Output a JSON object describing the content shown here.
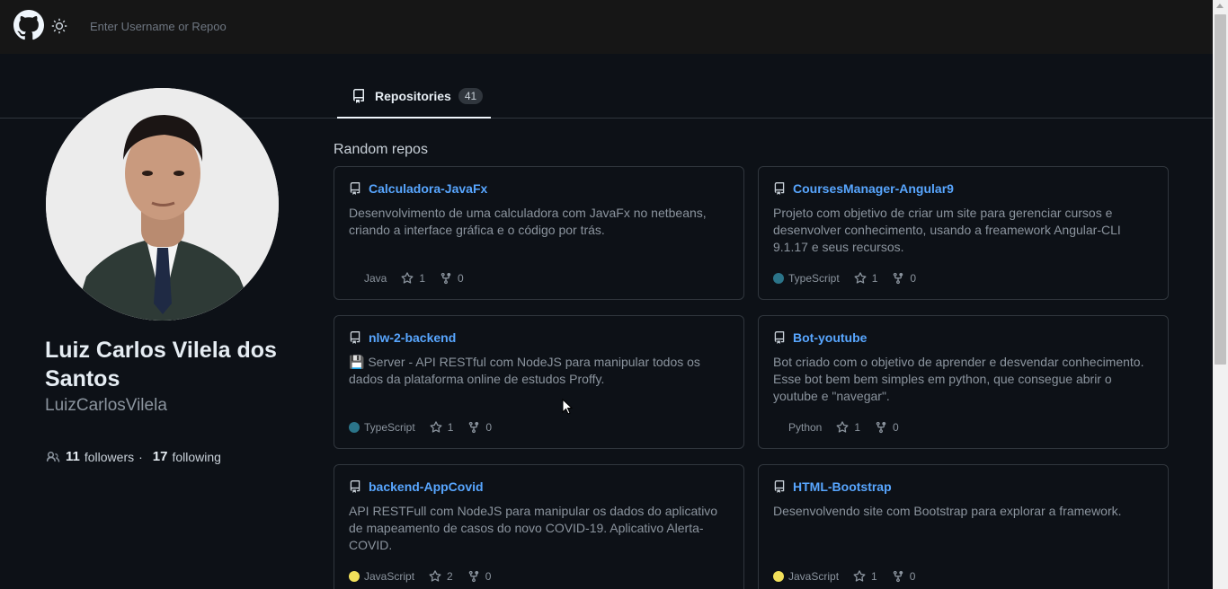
{
  "header": {
    "search_placeholder": "Enter Username or Repoo"
  },
  "tabs": [
    {
      "label": "Repositories",
      "count": "41"
    }
  ],
  "profile": {
    "name": "Luiz Carlos Vilela dos Santos",
    "login": "LuizCarlosVilela",
    "followers_count": "11",
    "followers_label": "followers",
    "separator": "·",
    "following_count": "17",
    "following_label": "following"
  },
  "section_title": "Random repos",
  "repos": [
    {
      "name": "Calculadora-JavaFx",
      "description": "Desenvolvimento de uma calculadora com JavaFx no netbeans, criando a interface gráfica e o código por trás.",
      "language": "Java",
      "language_color": "",
      "stars": "1",
      "forks": "0"
    },
    {
      "name": "CoursesManager-Angular9",
      "description": "Projeto com objetivo de criar um site para gerenciar cursos e desenvolver conhecimento, usando a freamework Angular-CLI 9.1.17 e seus recursos.",
      "language": "TypeScript",
      "language_color": "#2b7489",
      "stars": "1",
      "forks": "0"
    },
    {
      "name": "nlw-2-backend",
      "description": "💾 Server - API RESTful com NodeJS para manipular todos os dados da plataforma online de estudos Proffy.",
      "language": "TypeScript",
      "language_color": "#2b7489",
      "stars": "1",
      "forks": "0"
    },
    {
      "name": "Bot-youtube",
      "description": "Bot criado com o objetivo de aprender e desvendar conhecimento. Esse bot bem bem simples em python, que consegue abrir o youtube e \"navegar\".",
      "language": "Python",
      "language_color": "",
      "stars": "1",
      "forks": "0"
    },
    {
      "name": "backend-AppCovid",
      "description": "API RESTFull com NodeJS para manipular os dados do aplicativo de mapeamento de casos do novo COVID-19. Aplicativo Alerta-COVID.",
      "language": "JavaScript",
      "language_color": "#f1e05a",
      "stars": "2",
      "forks": "0"
    },
    {
      "name": "HTML-Bootstrap",
      "description": "Desenvolvendo site com Bootstrap para explorar a framework.",
      "language": "JavaScript",
      "language_color": "#f1e05a",
      "stars": "1",
      "forks": "0"
    }
  ]
}
